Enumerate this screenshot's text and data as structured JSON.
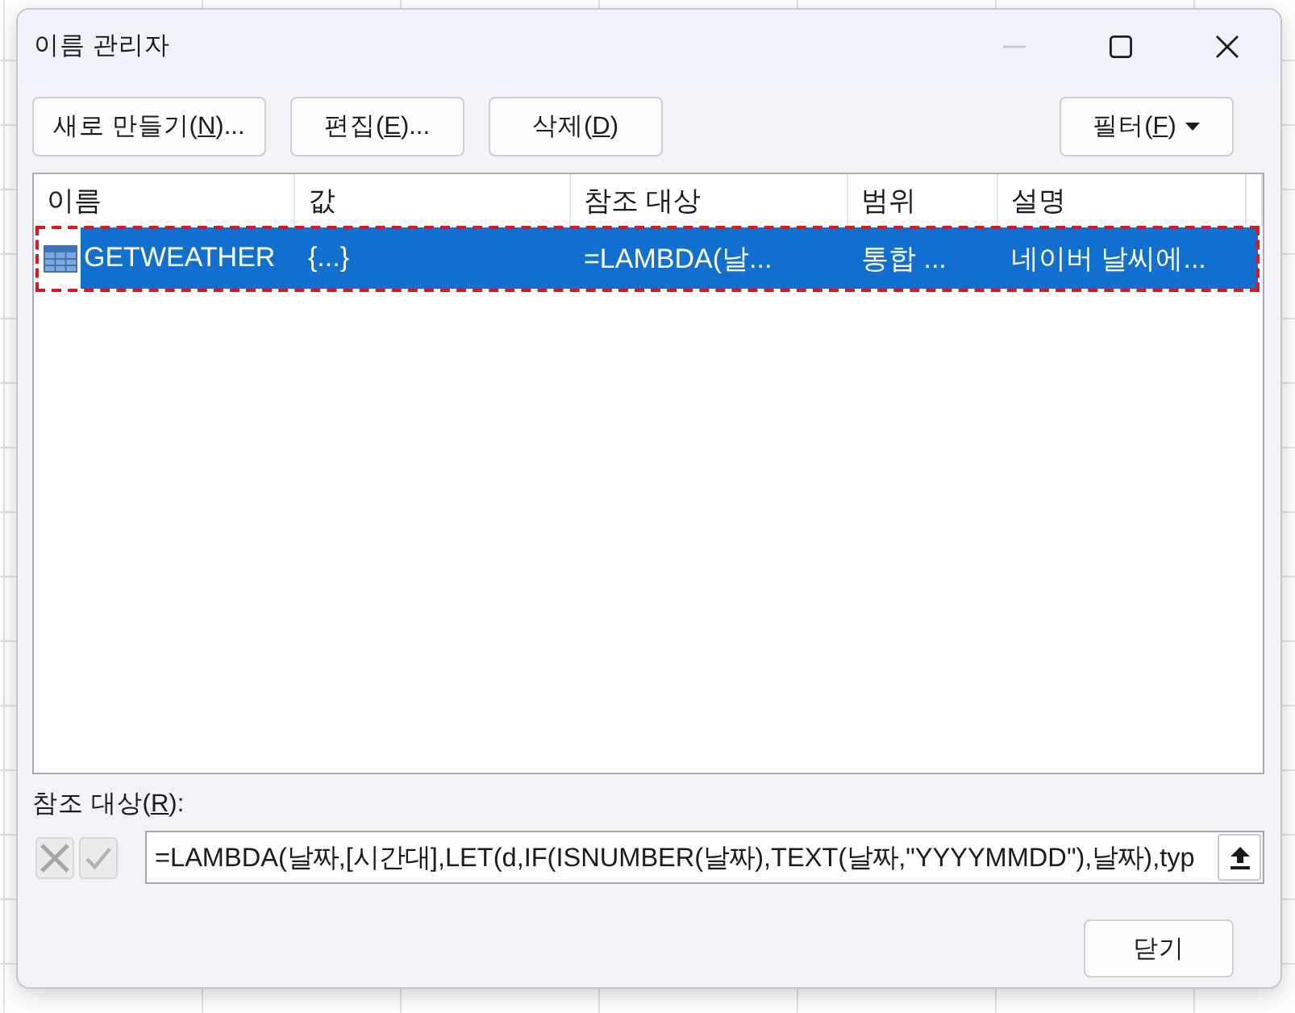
{
  "window": {
    "title": "이름 관리자",
    "controls": [
      {
        "kind": "minimize",
        "disabled": true
      },
      {
        "kind": "maximize",
        "disabled": false
      },
      {
        "kind": "close",
        "disabled": false
      }
    ]
  },
  "toolbar": {
    "buttons": [
      {
        "kind": "plain",
        "text_before": "새로 만들기(",
        "access_key": "N",
        "text_after": ")..."
      },
      {
        "kind": "plain",
        "text_before": "편집(",
        "access_key": "E",
        "text_after": ")..."
      },
      {
        "kind": "plain",
        "text_before": "삭제(",
        "access_key": "D",
        "text_after": ")"
      },
      {
        "kind": "dropdown",
        "text_before": "필터(",
        "access_key": "F",
        "text_after": ")"
      }
    ]
  },
  "list": {
    "columns": [
      "이름",
      "값",
      "참조 대상",
      "범위",
      "설명"
    ],
    "rows": [
      {
        "cells": [
          "GETWEATHER",
          "{...}",
          "=LAMBDA(날...",
          "통합 ...",
          "네이버 날씨에..."
        ],
        "selected": true,
        "annotated": true
      }
    ]
  },
  "reference": {
    "label": {
      "text_before": "참조 대상(",
      "access_key": "R",
      "text_after": "):"
    },
    "buttons": [
      {
        "kind": "cancel",
        "disabled": true
      },
      {
        "kind": "enter",
        "disabled": true
      }
    ],
    "value": "=LAMBDA(날짜,[시간대],LET(d,IF(ISNUMBER(날짜),TEXT(날짜,\"YYYYMMDD\"),날짜),typ"
  },
  "footer": {
    "buttons": [
      "닫기"
    ]
  }
}
